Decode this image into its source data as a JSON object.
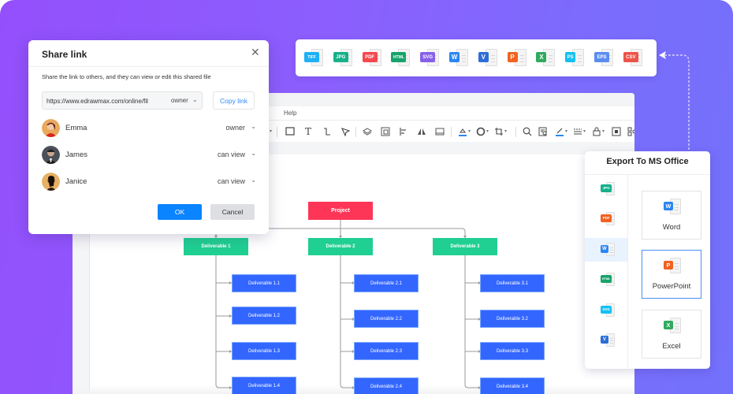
{
  "colors": {
    "background_start": "#944ffc",
    "background_end": "#7371fb",
    "root_node": "#fd3657",
    "level1_node": "#20cf92",
    "level2_node": "#3366ff",
    "primary_button": "#0a84ff",
    "link_blue": "#2b8cff"
  },
  "share_dialog": {
    "title": "Share link",
    "close_icon": "close-icon",
    "description": "Share the link to others, and they can view or edit this shared file",
    "url_value": "https://www.edrawmax.com/online/fil",
    "url_role": "owner",
    "copy_label": "Copy link",
    "members": [
      {
        "name": "Emma",
        "role": "owner",
        "avatar": "avatar-emma"
      },
      {
        "name": "James",
        "role": "can view",
        "avatar": "avatar-james"
      },
      {
        "name": "Janice",
        "role": "can view",
        "avatar": "avatar-janice"
      }
    ],
    "ok_label": "OK",
    "cancel_label": "Cancel"
  },
  "export_formats": [
    {
      "label": "TIFF",
      "color": "#1fb0f5"
    },
    {
      "label": "JPG",
      "color": "#16b08a"
    },
    {
      "label": "PDF",
      "color": "#f5474f"
    },
    {
      "label": "HTML",
      "color": "#17a36b"
    },
    {
      "label": "SVG",
      "color": "#8661e8"
    },
    {
      "label": "W",
      "color": "#2b86f5"
    },
    {
      "label": "V",
      "color": "#2c6ed6"
    },
    {
      "label": "P",
      "color": "#f2621f"
    },
    {
      "label": "X",
      "color": "#2faa5e"
    },
    {
      "label": "PS",
      "color": "#14c0f2"
    },
    {
      "label": "EPS",
      "color": "#5b8cf0"
    },
    {
      "label": "CSV",
      "color": "#ec5448"
    }
  ],
  "editor": {
    "menu_help": "Help",
    "toolbar_icons": [
      "rectangle-icon",
      "text-icon",
      "connector-icon",
      "pointer-icon",
      "layers-icon",
      "group-icon",
      "align-icon",
      "flip-icon",
      "frame-icon",
      "fill-icon",
      "shape-style-icon",
      "crop-icon",
      "search-icon",
      "find-replace-icon",
      "line-color-icon",
      "line-style-icon",
      "lock-icon",
      "fit-icon",
      "more-icon"
    ]
  },
  "org_chart": {
    "root": "Project",
    "deliverables": [
      {
        "label": "Deliverable 1",
        "children": [
          "Deliverable 1.1",
          "Deliverable 1.2",
          "Deliverable 1.3",
          "Deliverable 1.4"
        ]
      },
      {
        "label": "Deliverable 2",
        "children": [
          "Deliverable 2.1",
          "Deliverable 2.2",
          "Deliverable 2.3",
          "Deliverable 2.4"
        ]
      },
      {
        "label": "Deliverable 3",
        "children": [
          "Deliverable 3.1",
          "Deliverable 3.2",
          "Deliverable 3.3",
          "Deliverable 3.4"
        ]
      }
    ]
  },
  "office_panel": {
    "title": "Export To MS Office",
    "side_formats": [
      {
        "label": "JPG",
        "color": "#16b08a"
      },
      {
        "label": "PDF",
        "color": "#f2621f"
      },
      {
        "label": "W",
        "color": "#2b86f5",
        "active": true
      },
      {
        "label": "HTML",
        "color": "#17a36b"
      },
      {
        "label": "SVG",
        "color": "#14c0f2"
      },
      {
        "label": "V",
        "color": "#2c6ed6"
      }
    ],
    "options": [
      {
        "label": "Word",
        "badge": "W",
        "color": "#2b86f5",
        "selected": false
      },
      {
        "label": "PowerPoint",
        "badge": "P",
        "color": "#f2621f",
        "selected": true
      },
      {
        "label": "Excel",
        "badge": "X",
        "color": "#2faa5e",
        "selected": false
      }
    ]
  }
}
